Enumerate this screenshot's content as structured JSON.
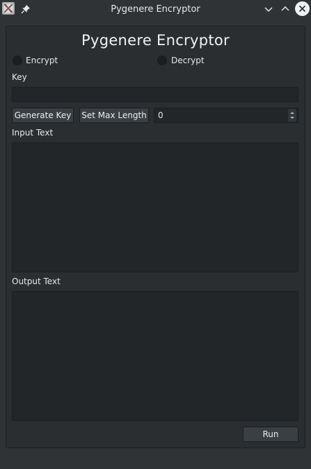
{
  "window": {
    "title": "Pygenere Encryptor"
  },
  "app": {
    "heading": "Pygenere Encryptor",
    "mode_options": [
      {
        "label": "Encrypt",
        "checked": false
      },
      {
        "label": "Decrypt",
        "checked": false
      }
    ],
    "key_label": "Key",
    "key_value": "",
    "generate_key_label": "Generate Key",
    "set_max_length_label": "Set Max Length",
    "max_length_value": "0",
    "input_label": "Input Text",
    "input_value": "",
    "output_label": "Output Text",
    "output_value": "",
    "run_label": "Run"
  },
  "icons": {
    "app": "app-icon",
    "pin": "pin-icon",
    "minimize": "chevron-down-icon",
    "maximize": "chevron-up-icon",
    "close": "close-icon"
  },
  "colors": {
    "window_bg": "#2f3336",
    "panel_bg": "#2b2e31",
    "field_bg": "#232629",
    "button_bg": "#3a3f43"
  }
}
